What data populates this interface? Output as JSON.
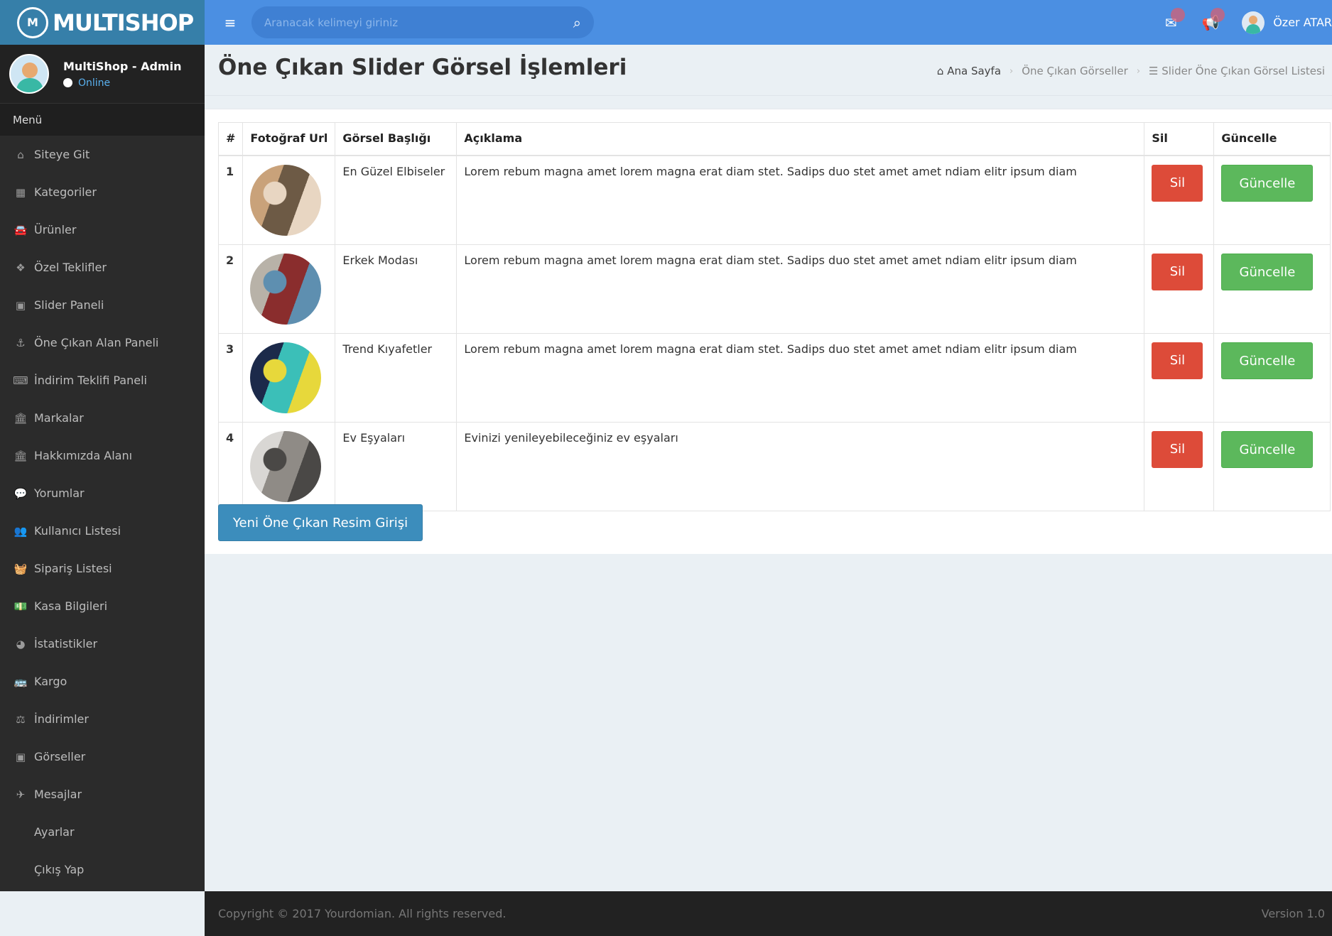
{
  "brand": {
    "name": "MULTISHOP",
    "logo_mark": "M"
  },
  "topbar": {
    "search_placeholder": "Aranacak kelimeyi giriniz",
    "username": "Özer ATAR"
  },
  "user_panel": {
    "name": "MultiShop - Admin",
    "status": "Online"
  },
  "sidebar": {
    "header": "Menü",
    "items": [
      {
        "label": "Siteye Git",
        "icon": "home-icon",
        "glyph": "⌂"
      },
      {
        "label": "Kategoriler",
        "icon": "grid-icon",
        "glyph": "▦"
      },
      {
        "label": "Ürünler",
        "icon": "car-icon",
        "glyph": "🚘"
      },
      {
        "label": "Özel Teklifler",
        "icon": "cubes-icon",
        "glyph": "❖"
      },
      {
        "label": "Slider Paneli",
        "icon": "image-icon",
        "glyph": "▣"
      },
      {
        "label": "Öne Çıkan Alan Paneli",
        "icon": "anchor-icon",
        "glyph": "⚓"
      },
      {
        "label": "İndirim Teklifi Paneli",
        "icon": "keyboard-icon",
        "glyph": "⌨"
      },
      {
        "label": "Markalar",
        "icon": "bank-icon",
        "glyph": "🏛"
      },
      {
        "label": "Hakkımızda Alanı",
        "icon": "bank-icon",
        "glyph": "🏛"
      },
      {
        "label": "Yorumlar",
        "icon": "comment-icon",
        "glyph": "💬"
      },
      {
        "label": "Kullanıcı Listesi",
        "icon": "users-icon",
        "glyph": "👥"
      },
      {
        "label": "Sipariş Listesi",
        "icon": "basket-icon",
        "glyph": "🧺"
      },
      {
        "label": "Kasa Bilgileri",
        "icon": "money-icon",
        "glyph": "💵"
      },
      {
        "label": "İstatistikler",
        "icon": "pie-chart-icon",
        "glyph": "◕"
      },
      {
        "label": "Kargo",
        "icon": "bus-icon",
        "glyph": "🚌"
      },
      {
        "label": "İndirimler",
        "icon": "balance-scale-icon",
        "glyph": "⚖"
      },
      {
        "label": "Görseller",
        "icon": "image-icon",
        "glyph": "▣"
      },
      {
        "label": "Mesajlar",
        "icon": "paper-plane-icon",
        "glyph": "✈"
      },
      {
        "label": "Ayarlar",
        "icon": "none",
        "glyph": "",
        "indent": true
      },
      {
        "label": "Çıkış Yap",
        "icon": "none",
        "glyph": "",
        "indent": true
      }
    ]
  },
  "page": {
    "title": "Öne Çıkan Slider Görsel İşlemleri",
    "breadcrumb": {
      "home": "Ana Sayfa",
      "middle": "Öne Çıkan Görseller",
      "current": "Slider Öne Çıkan Görsel Listesi"
    }
  },
  "table": {
    "headers": [
      "#",
      "Fotoğraf Url",
      "Görsel Başlığı",
      "Açıklama",
      "Sil",
      "Güncelle"
    ],
    "rows": [
      {
        "num": "1",
        "title": "En Güzel Elbiseler",
        "desc": "Lorem rebum magna amet lorem magna erat diam stet. Sadips duo stet amet amet ndiam elitr ipsum diam",
        "photo_colors": [
          "#c9a27a",
          "#6d5a45",
          "#e8d6c2"
        ]
      },
      {
        "num": "2",
        "title": "Erkek Modası",
        "desc": "Lorem rebum magna amet lorem magna erat diam stet. Sadips duo stet amet amet ndiam elitr ipsum diam",
        "photo_colors": [
          "#b8b2a8",
          "#8a2d2d",
          "#5e8fb0"
        ]
      },
      {
        "num": "3",
        "title": "Trend Kıyafetler",
        "desc": "Lorem rebum magna amet lorem magna erat diam stet. Sadips duo stet amet amet ndiam elitr ipsum diam",
        "photo_colors": [
          "#1c2a4a",
          "#3bbfb8",
          "#e7d83b"
        ]
      },
      {
        "num": "4",
        "title": "Ev Eşyaları",
        "desc": "Evinizi yenileyebileceğiniz ev eşyaları",
        "photo_colors": [
          "#d9d7d4",
          "#8f8b86",
          "#4a4846"
        ]
      }
    ],
    "delete_label": "Sil",
    "update_label": "Güncelle"
  },
  "new_button": "Yeni Öne Çıkan Resim Girişi",
  "footer": {
    "copyright": "Copyright © 2017 Yourdomian. All rights reserved.",
    "version": "Version 1.0"
  },
  "colors": {
    "topbar": "#4b8fe2",
    "sidebar": "#2b2b2b",
    "delete": "#dd4b39",
    "update": "#5cb85c",
    "primary": "#3c8dbc"
  }
}
